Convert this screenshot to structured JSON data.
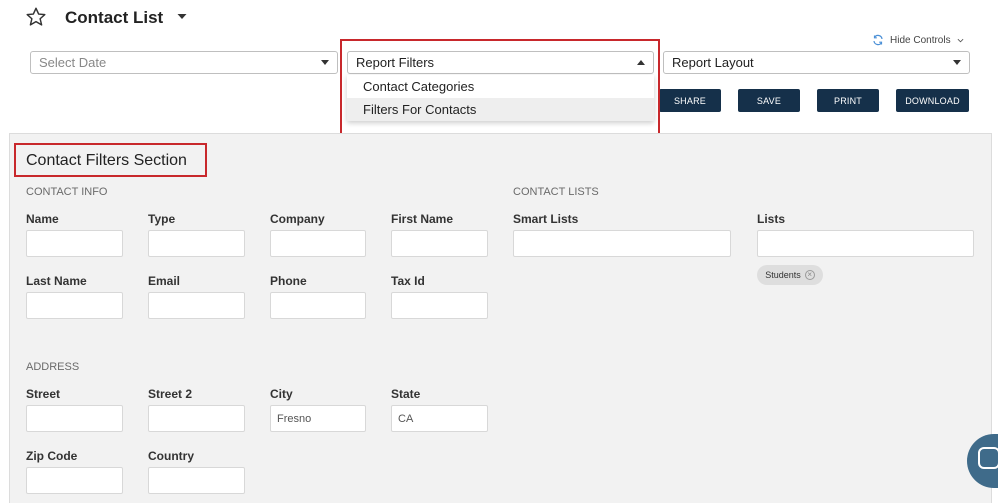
{
  "header": {
    "title": "Contact List"
  },
  "controls": {
    "hide_controls": "Hide Controls",
    "date_placeholder": "Select Date",
    "report_filters": "Report Filters",
    "report_layout": "Report Layout",
    "filters_menu": [
      "Contact Categories",
      "Filters For Contacts"
    ],
    "buttons": {
      "share": "SHARE",
      "save": "SAVE",
      "print": "PRINT",
      "download": "DOWNLOAD"
    }
  },
  "section": {
    "title": "Contact Filters Section",
    "contact_info": "CONTACT INFO",
    "contact_lists": "CONTACT LISTS",
    "address": "ADDRESS",
    "fields": {
      "name": "Name",
      "type": "Type",
      "company": "Company",
      "first_name": "First Name",
      "last_name": "Last Name",
      "email": "Email",
      "phone": "Phone",
      "tax_id": "Tax Id",
      "smart_lists": "Smart Lists",
      "lists": "Lists",
      "street": "Street",
      "street2": "Street 2",
      "city": "City",
      "state": "State",
      "zip": "Zip Code",
      "country": "Country"
    },
    "values": {
      "city": "Fresno",
      "state": "CA",
      "list_tag": "Students"
    }
  },
  "colors": {
    "highlight": "#c8282c",
    "button": "#15304a",
    "panel": "#f2f2f2"
  }
}
